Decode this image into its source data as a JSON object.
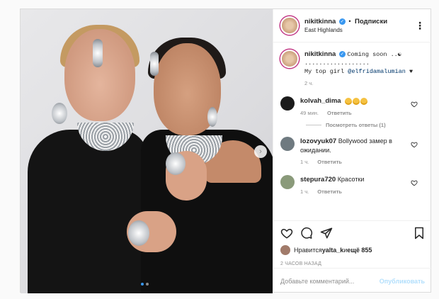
{
  "post": {
    "author": {
      "username": "nikitkinna",
      "verified": true,
      "follow_separator": "•",
      "follow_label": "Подписки",
      "location": "East Highlands",
      "more_icon": "more-horizontal-icon"
    },
    "caption": {
      "username": "nikitkinna",
      "line1": "Coming soon ..☯",
      "dots": "..................",
      "line3_prefix": "My top girl ",
      "mention": "@elfridamalumian",
      "line3_suffix": " ♥",
      "time": "2 ч."
    },
    "comments": [
      {
        "username": "kolvah_dima",
        "text": "",
        "emoji_count": 3,
        "time": "49 мин.",
        "reply_label": "Ответить",
        "avatar_color": "#1b1b1b"
      },
      {
        "username": "lozovyuk07",
        "text": "Bollywood замер в ожидании.",
        "time": "1 ч.",
        "reply_label": "Ответить",
        "avatar_color": "#6f7a80"
      },
      {
        "username": "stepura720",
        "text": "Красотки",
        "time": "1 ч.",
        "reply_label": "Ответить",
        "avatar_color": "#8a9a7a"
      }
    ],
    "view_replies": "Посмотреть ответы (1)",
    "likes": {
      "prefix": "Нравится ",
      "user": "yalta_k",
      "middle": " и ",
      "rest": "ещё 855"
    },
    "timestamp": "2 ЧАСОВ НАЗАД",
    "comment_input": {
      "placeholder": "Добавьте комментарий...",
      "value": ""
    },
    "publish_label": "Опубликовать",
    "carousel": {
      "slides": 2,
      "active": 0,
      "next_icon": "chevron-right-icon"
    }
  },
  "colors": {
    "link": "#3897f0",
    "text": "#262626",
    "muted": "#8e8e8e",
    "publish_disabled": "#b2dffc"
  }
}
